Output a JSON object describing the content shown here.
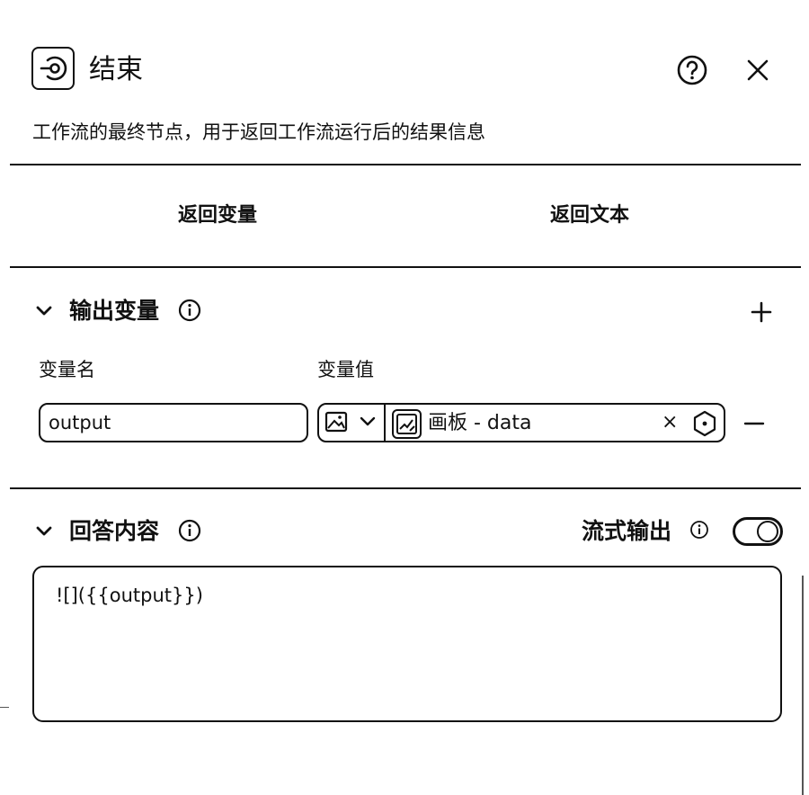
{
  "header": {
    "icon": "end-node-icon",
    "title": "结束",
    "help_icon": "help-circle-icon",
    "close_icon": "close-icon",
    "description": "工作流的最终节点，用于返回工作流运行后的结果信息"
  },
  "tabs": [
    {
      "label": "返回变量"
    },
    {
      "label": "返回文本"
    }
  ],
  "output_section": {
    "title": "输出变量",
    "add_icon": "plus-icon",
    "columns": {
      "name": "变量名",
      "value": "变量值"
    },
    "rows": [
      {
        "name": "output",
        "type_icon": "image-icon",
        "ref_icon": "canvas-icon",
        "ref_label": "画板 - data",
        "clear": "×"
      }
    ]
  },
  "answer_section": {
    "title": "回答内容",
    "stream_label": "流式输出",
    "stream_on": true,
    "content": "![]({{output}})"
  }
}
